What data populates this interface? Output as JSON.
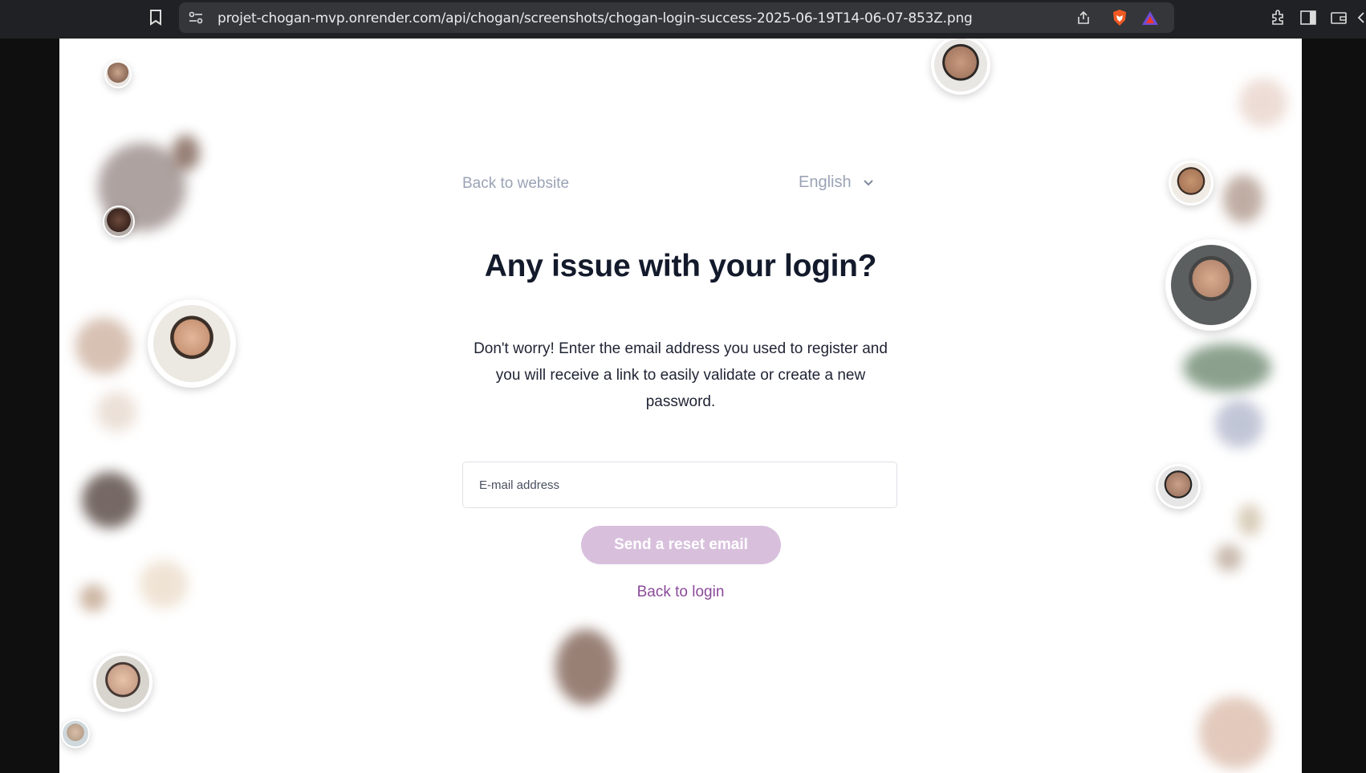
{
  "browser": {
    "url": "projet-chogan-mvp.onrender.com/api/chogan/screenshots/chogan-login-success-2025-06-19T14-06-07-853Z.png"
  },
  "page": {
    "back_to_website": "Back to website",
    "language": "English",
    "title": "Any issue with your login?",
    "description": "Don't worry! Enter the email address you used to register and you will receive a link to easily validate or create a new password.",
    "email_placeholder": "E-mail address",
    "send_button": "Send a reset email",
    "back_to_login": "Back to login"
  },
  "colors": {
    "title": "#131a2b",
    "muted_link": "#9aa3b5",
    "accent_link": "#8a4a99",
    "send_button_bg": "#d8c0dd"
  }
}
